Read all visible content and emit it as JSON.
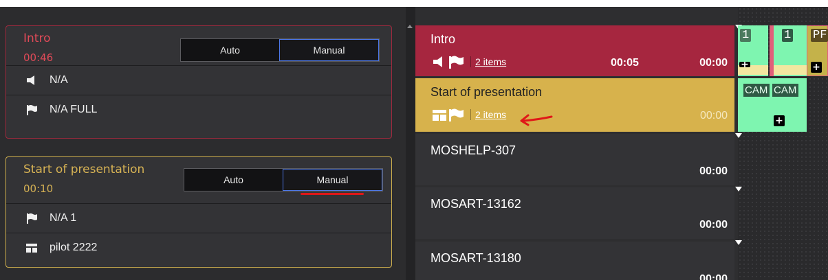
{
  "left": {
    "intro": {
      "title": "Intro",
      "time": "00:46",
      "mode": {
        "auto": "Auto",
        "manual": "Manual",
        "selected": "Manual"
      },
      "items": [
        {
          "icon": "speaker-icon",
          "label": "N/A"
        },
        {
          "icon": "flag-icon",
          "label": "N/A FULL"
        }
      ]
    },
    "start": {
      "title": "Start of presentation",
      "time": "00:10",
      "mode": {
        "auto": "Auto",
        "manual": "Manual",
        "selected": "Manual"
      },
      "items": [
        {
          "icon": "flag-icon",
          "label": "N/A 1"
        },
        {
          "icon": "layout-icon",
          "label": "pilot 2222"
        }
      ]
    }
  },
  "rundown": {
    "stories": [
      {
        "title": "Intro",
        "items_link": "2 items",
        "duration": "00:05",
        "time": "00:00",
        "color": "#a6263f"
      },
      {
        "title": "Start of presentation",
        "items_link": "2 items",
        "time": "00:00",
        "color": "#d7b24c"
      },
      {
        "title": "MOSHELP-307",
        "time": "00:00"
      },
      {
        "title": "MOSART-13162",
        "time": "00:00"
      },
      {
        "title": "MOSART-13180",
        "time": "00:00"
      }
    ],
    "timeline": {
      "badges": [
        "1",
        "1",
        "PF"
      ],
      "cams": [
        "CAM",
        "CAM"
      ]
    }
  },
  "colors": {
    "intro": "#a6263f",
    "start": "#d7b24c",
    "selected_border": "#4d78e8",
    "annotation": "#e01818",
    "timeline_green": "#7ef5b0",
    "timeline_olive": "#c4b24a"
  }
}
